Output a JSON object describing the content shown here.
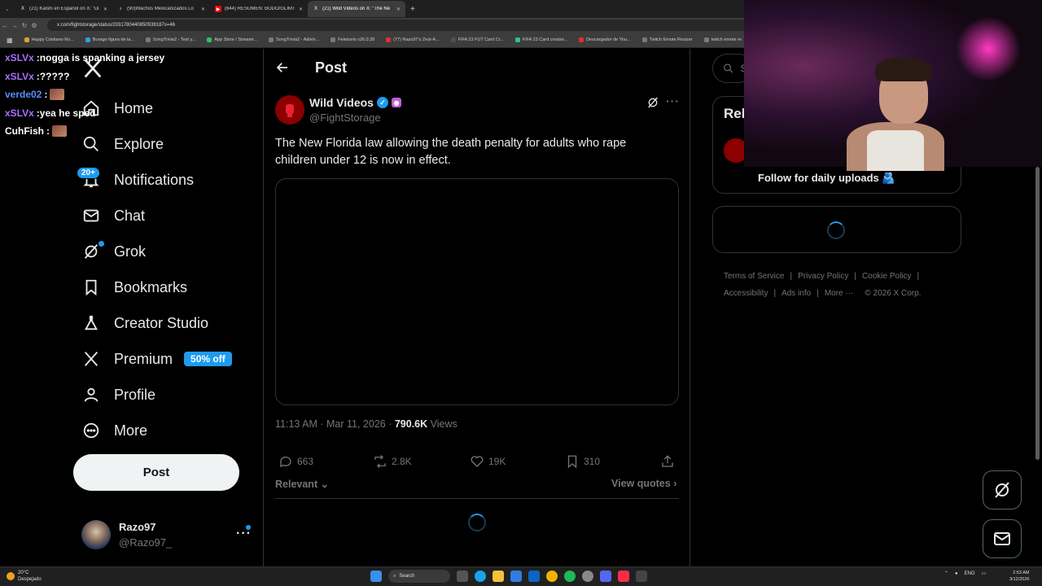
{
  "browser": {
    "tabs": [
      {
        "title": "(21) Kalshi en Español on X: \"Di",
        "icon_color": "#000000",
        "glyph": "X"
      },
      {
        "title": "(90)Wachos Mexicanizados Lo",
        "icon_color": "#000000",
        "glyph": "♪"
      },
      {
        "title": "(644) RESUMEN: BODO/GLIMT",
        "icon_color": "#ff0000",
        "glyph": "▶"
      },
      {
        "title": "(21) Wild Videos on X: \"The Ne",
        "icon_color": "#000000",
        "glyph": "X"
      }
    ],
    "url": "x.com/fightstorage/status/2031780440850539187s=46",
    "bookmarks": [
      {
        "label": "Happy Cristiano Ro...",
        "color": "#e0a030"
      },
      {
        "label": "Burago figura de la...",
        "color": "#30a0e0"
      },
      {
        "label": "SongTrivia2 - Test y...",
        "color": "#7a7a7a"
      },
      {
        "label": "App Store / Streami...",
        "color": "#30c060"
      },
      {
        "label": "SongTrivia2 - Adivin...",
        "color": "#7a7a7a"
      },
      {
        "label": "Feletools v26.0.28",
        "color": "#7a7a7a"
      },
      {
        "label": "(77) Razo97's Zest-A...",
        "color": "#e03030"
      },
      {
        "label": "FIFA 23 FUT Card Cr...",
        "color": "#505050"
      },
      {
        "label": "FIFA 23 Card creator...",
        "color": "#30c0a0"
      },
      {
        "label": "Descargador de You...",
        "color": "#e03030"
      },
      {
        "label": "Twitch Emote Resizer",
        "color": "#7a7a7a"
      },
      {
        "label": "twitch emote re",
        "color": "#7a7a7a"
      }
    ]
  },
  "chat": [
    {
      "user": "xSLVx",
      "color": "#a970ff",
      "message": "nogga is spanking a jersey",
      "emote": false
    },
    {
      "user": "xSLVx",
      "color": "#a970ff",
      "message": "?????",
      "emote": false
    },
    {
      "user": "verde02",
      "color": "#5b8cff",
      "message": "",
      "emote": true
    },
    {
      "user": "xSLVx",
      "color": "#a970ff",
      "message": "yea he sped",
      "emote": false
    },
    {
      "user": "CuhFish",
      "color": "#ffffff",
      "message": "",
      "emote": true
    }
  ],
  "nav": {
    "items": [
      {
        "label": "Home",
        "icon": "home-icon"
      },
      {
        "label": "Explore",
        "icon": "search-icon"
      },
      {
        "label": "Notifications",
        "icon": "bell-icon"
      },
      {
        "label": "Chat",
        "icon": "mail-icon"
      },
      {
        "label": "Grok",
        "icon": "grok-icon"
      },
      {
        "label": "Bookmarks",
        "icon": "bookmark-icon"
      },
      {
        "label": "Creator Studio",
        "icon": "flask-icon"
      },
      {
        "label": "Premium",
        "icon": "x-icon"
      },
      {
        "label": "Profile",
        "icon": "person-icon"
      },
      {
        "label": "More",
        "icon": "more-circle-icon"
      }
    ],
    "notifications_badge": "20+",
    "premium_badge": "50% off",
    "post_button": "Post"
  },
  "account": {
    "name": "Razo97",
    "handle": "@Razo97_"
  },
  "post": {
    "header_title": "Post",
    "author_name": "Wild Videos",
    "author_handle": "@FightStorage",
    "text": "The New Florida law allowing the death penalty for adults who rape children under 12 is now in effect.",
    "timestamp": "11:13 AM · Mar 11, 2026 · ",
    "views_count": "790.6K",
    "views_label": " Views",
    "replies": "663",
    "reposts": "2.8K",
    "likes": "19K",
    "bookmarks": "310",
    "sort_label": "Relevant",
    "view_quotes": "View quotes"
  },
  "right": {
    "search_placeholder": "Se",
    "relevant_title": "Rel",
    "relevant_bio": "Follow for daily uploads 🫂",
    "footer": [
      "Terms of Service",
      "Privacy Policy",
      "Cookie Policy",
      "Accessibility",
      "Ads info",
      "More ···",
      "© 2026 X Corp."
    ]
  },
  "taskbar": {
    "temp": "20°C",
    "weather": "Despejado",
    "search": "Search",
    "lang": "ENG",
    "time": "2:53 AM",
    "date": "3/12/2026"
  },
  "colors": {
    "accent": "#1d9bf0",
    "background": "#000000",
    "text": "#e7e9ea",
    "muted": "#71767b"
  }
}
